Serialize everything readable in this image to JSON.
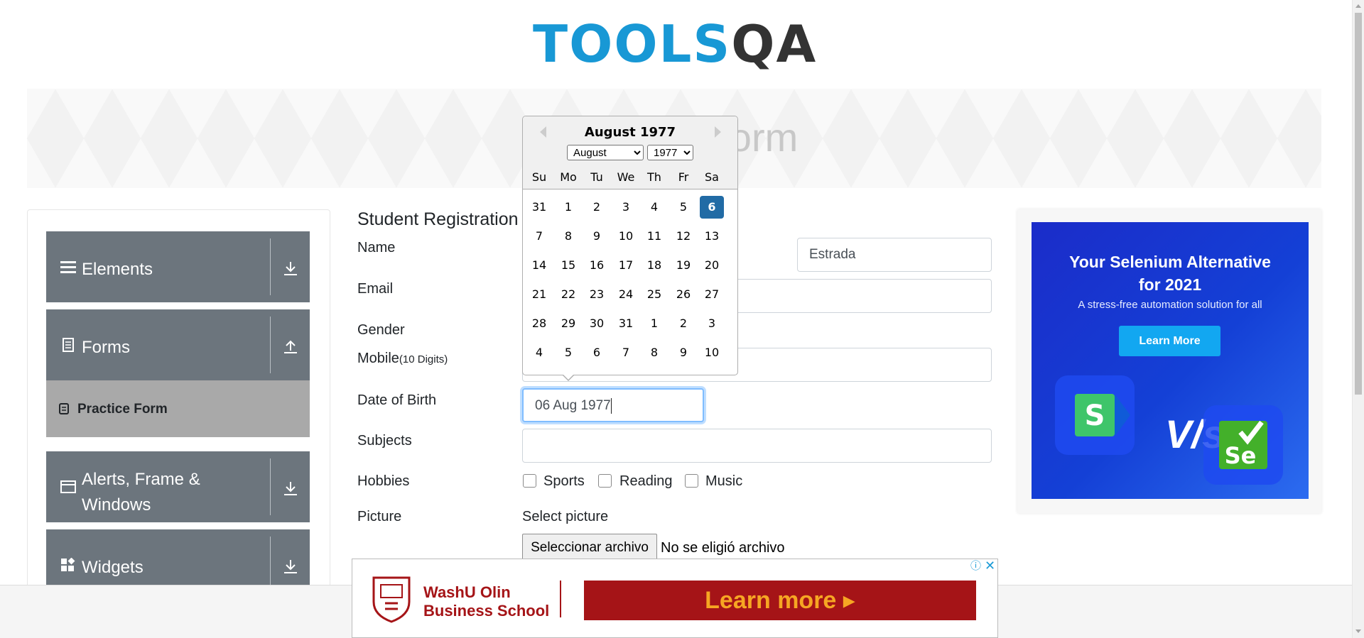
{
  "logo": {
    "tools": "TOOLS",
    "qa": "QA"
  },
  "banner": {
    "title": "Practice Form"
  },
  "sidebar": {
    "groups": [
      {
        "label": "Elements",
        "icon": "hamburger-icon",
        "toggle": "expand-arrow-icon"
      },
      {
        "label": "Forms",
        "icon": "document-icon",
        "toggle": "collapse-arrow-icon"
      },
      {
        "label": "Alerts, Frame & Windows",
        "icon": "window-icon",
        "toggle": "expand-arrow-icon"
      },
      {
        "label": "Widgets",
        "icon": "widgets-icon",
        "toggle": "expand-arrow-icon"
      }
    ],
    "active_item": {
      "label": "Practice Form",
      "icon": "form-icon"
    }
  },
  "form": {
    "heading": "Student Registration Form",
    "labels": {
      "name": "Name",
      "email": "Email",
      "gender": "Gender",
      "mobile": "Mobile",
      "mobile_hint": "(10 Digits)",
      "dob": "Date of Birth",
      "subjects": "Subjects",
      "hobbies": "Hobbies",
      "picture": "Picture"
    },
    "last_name_value": "Estrada",
    "dob_value": "06 Aug 1977",
    "hobbies": [
      "Sports",
      "Reading",
      "Music"
    ],
    "picture_prompt": "Select picture",
    "file_button": "Seleccionar archivo",
    "file_status": "No se eligió archivo"
  },
  "datepicker": {
    "title": "August 1977",
    "month_select": "August",
    "year_select": "1977",
    "weekdays": [
      "Su",
      "Mo",
      "Tu",
      "We",
      "Th",
      "Fr",
      "Sa"
    ],
    "weeks": [
      [
        "31",
        "1",
        "2",
        "3",
        "4",
        "5",
        "6"
      ],
      [
        "7",
        "8",
        "9",
        "10",
        "11",
        "12",
        "13"
      ],
      [
        "14",
        "15",
        "16",
        "17",
        "18",
        "19",
        "20"
      ],
      [
        "21",
        "22",
        "23",
        "24",
        "25",
        "26",
        "27"
      ],
      [
        "28",
        "29",
        "30",
        "31",
        "1",
        "2",
        "3"
      ],
      [
        "4",
        "5",
        "6",
        "7",
        "8",
        "9",
        "10"
      ]
    ],
    "selected_day": "6"
  },
  "ad_right": {
    "headline_line1": "Your Selenium Alternative",
    "headline_line2": "for 2021",
    "subtext": "A stress-free automation solution for all",
    "button": "Learn More",
    "versus": "V/s",
    "logo_left": "S",
    "logo_right": "Se"
  },
  "ad_bottom": {
    "school_line1": "WashU Olin",
    "school_line2": "Business School",
    "cta": "Learn more ▸"
  },
  "colors": {
    "sidebar_group": "#6c757d",
    "active_item": "#a9a9a9",
    "selected_day": "#216ba5",
    "ad_blue": "#1440d6",
    "ad_red": "#a51417",
    "logo_blue": "#1898d5"
  }
}
